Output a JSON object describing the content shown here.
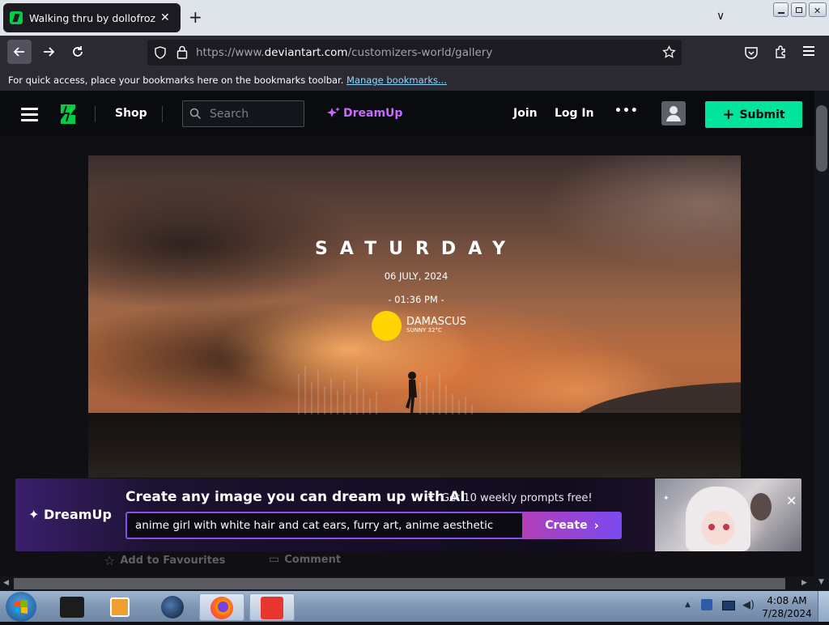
{
  "browser": {
    "tab_title": "Walking thru by dollofroz on De",
    "tab_close": "✕",
    "new_tab": "+",
    "tab_list": "∨",
    "url_dim_prefix": "https://www.",
    "url_host": "deviantart.com",
    "url_path": "/customizers-world/gallery",
    "bookmarks_hint": "For quick access, place your bookmarks here on the bookmarks toolbar.",
    "bookmarks_link": "Manage bookmarks..."
  },
  "header": {
    "shop": "Shop",
    "search_placeholder": "Search",
    "dreamup": "DreamUp",
    "join": "Join",
    "login": "Log In",
    "more": "•••",
    "submit": "Submit"
  },
  "artwork": {
    "day": "SATURDAY",
    "date": "06  JULY,  2024",
    "time": "- 01:36 PM -",
    "city": "DAMASCUS",
    "weather": "SUNNY 32°C"
  },
  "banner": {
    "logo": "DreamUp",
    "headline": "Create any image you can dream up with AI",
    "promo": "Get 10 weekly prompts free!",
    "prompt": "anime girl with white hair and cat ears, furry art, anime aesthetic",
    "create": "Create"
  },
  "actions": {
    "favourite": "Add to Favourites",
    "comment": "Comment"
  },
  "taskbar": {
    "time": "4:08 AM",
    "date": "7/28/2024"
  },
  "colors": {
    "accent_green": "#00e59b",
    "dreamup_purple": "#8b4df0",
    "sun_yellow": "#ffd400"
  }
}
